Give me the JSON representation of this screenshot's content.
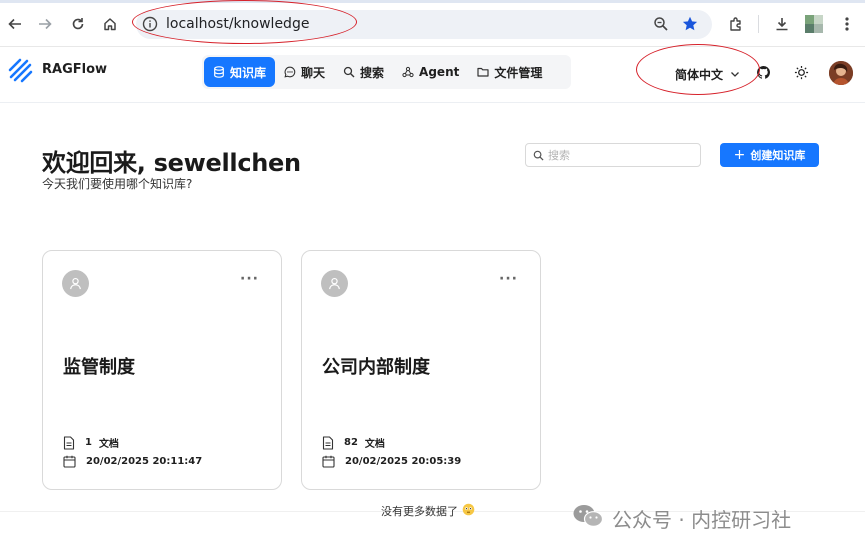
{
  "browser": {
    "url": "localhost/knowledge"
  },
  "app": {
    "brand": "RAGFlow",
    "nav": [
      {
        "label": "知识库",
        "icon": "database-icon",
        "active": true
      },
      {
        "label": "聊天",
        "icon": "chat-icon",
        "active": false
      },
      {
        "label": "搜索",
        "icon": "search-icon",
        "active": false
      },
      {
        "label": "Agent",
        "icon": "agent-graph-icon",
        "active": false
      },
      {
        "label": "文件管理",
        "icon": "folder-icon",
        "active": false
      }
    ],
    "language": "简体中文"
  },
  "main": {
    "welcome": "欢迎回来, sewellchen",
    "subtitle": "今天我们要使用哪个知识库?",
    "search_placeholder": "搜索",
    "create_label": "创建知识库",
    "no_more": "没有更多数据了"
  },
  "cards": [
    {
      "title": "监管制度",
      "doc_count": "1",
      "doc_unit": "文档",
      "date": "20/02/2025 20:11:47"
    },
    {
      "title": "公司内部制度",
      "doc_count": "82",
      "doc_unit": "文档",
      "date": "20/02/2025 20:05:39"
    }
  ],
  "watermark": "公众号 · 内控研习社",
  "colors": {
    "accent": "#1677ff",
    "annotation": "#d6222b"
  }
}
